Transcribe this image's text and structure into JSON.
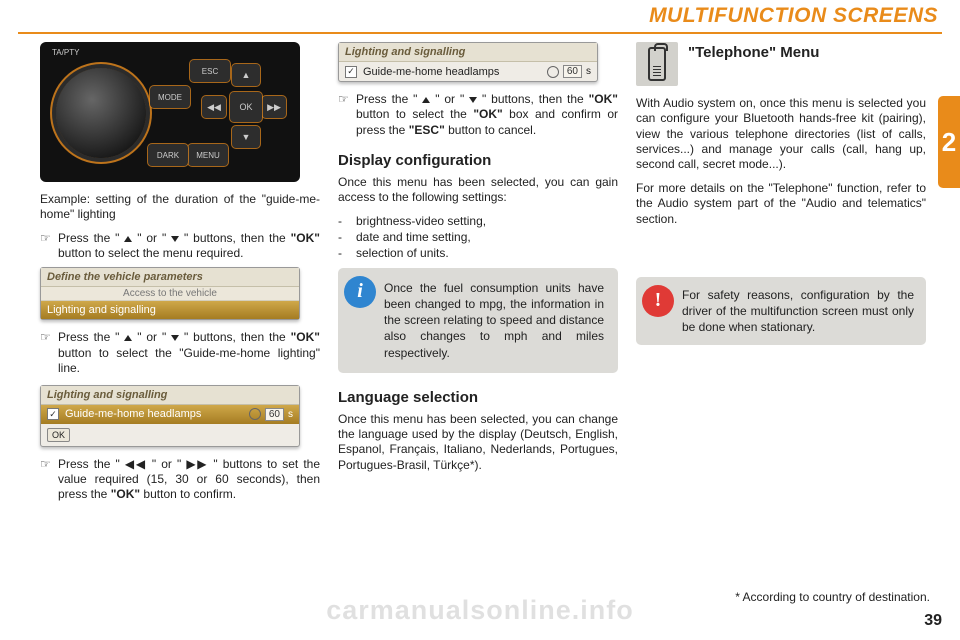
{
  "header": {
    "title": "MULTIFUNCTION SCREENS"
  },
  "side_tab": "2",
  "page_number": "39",
  "watermark": "carmanualsonline.info",
  "footnote": "* According to country of destination.",
  "col1": {
    "panel_labels": {
      "ta": "TA/PTY",
      "esc": "ESC",
      "mode": "MODE",
      "menu": "MENU",
      "dark": "DARK",
      "ok": "OK"
    },
    "example": "Example: setting of the duration of the \"guide-me-home\" lighting",
    "step1_pre": "Press the \" ",
    "step1_mid": " \" or \" ",
    "step1_post": " \" buttons, then the ",
    "step1_ok": "\"OK\"",
    "step1_tail": " button to select the menu required.",
    "ui1": {
      "title": "Define the vehicle parameters",
      "sub": "Access to the vehicle",
      "row": "Lighting and signalling"
    },
    "step2_pre": "Press the \" ",
    "step2_mid": " \" or \" ",
    "step2_post": " \" buttons, then the ",
    "step2_ok": "\"OK\"",
    "step2_tail": " button to select the \"Guide-me-home lighting\" line.",
    "ui2": {
      "title": "Lighting and signalling",
      "row": "Guide-me-home headlamps",
      "value": "60",
      "suffix": "s",
      "ok": "OK"
    },
    "step3_pre": "Press the \" ◀◀ \" or \" ▶▶ \" buttons to set the value required (15, 30 or 60 seconds), then press the ",
    "step3_ok": "\"OK\"",
    "step3_tail": " button to confirm."
  },
  "col2": {
    "ui": {
      "title": "Lighting and signalling",
      "row": "Guide-me-home headlamps",
      "value": "60",
      "suffix": "s"
    },
    "step_pre": "Press the \" ",
    "step_mid": " \" or \" ",
    "step_post": " \" buttons, then the ",
    "step_ok1": "\"OK\"",
    "step_mid2": " button to select the ",
    "step_ok2": "\"OK\"",
    "step_mid3": " box and confirm or press the ",
    "step_esc": "\"ESC\"",
    "step_tail": " button to cancel.",
    "h_display": "Display configuration",
    "display_intro": "Once this menu has been selected, you can gain access to the following settings:",
    "display_items": [
      "brightness-video setting,",
      "date and time setting,",
      "selection of units."
    ],
    "info_text": "Once the fuel consumption units have been changed to mpg, the information in the screen relating to speed and distance also changes to mph and miles respectively.",
    "h_lang": "Language selection",
    "lang_text": "Once this menu has been selected, you can change the language used by the display (Deutsch, English, Espanol, Français, Italiano, Nederlands, Portugues, Portugues-Brasil, Türkçe*)."
  },
  "col3": {
    "h_phone": "\"Telephone\" Menu",
    "phone_p1": "With Audio system on, once this menu is selected you can configure your Bluetooth hands-free kit (pairing), view the various telephone directories (list of calls, services...) and manage your calls (call, hang up, second call, secret mode...).",
    "phone_p2": "For more details on the \"Telephone\" function, refer to the Audio system part of the \"Audio and telematics\" section.",
    "warn_text": "For safety reasons, configuration by the driver of the multifunction screen must only be done when stationary."
  }
}
